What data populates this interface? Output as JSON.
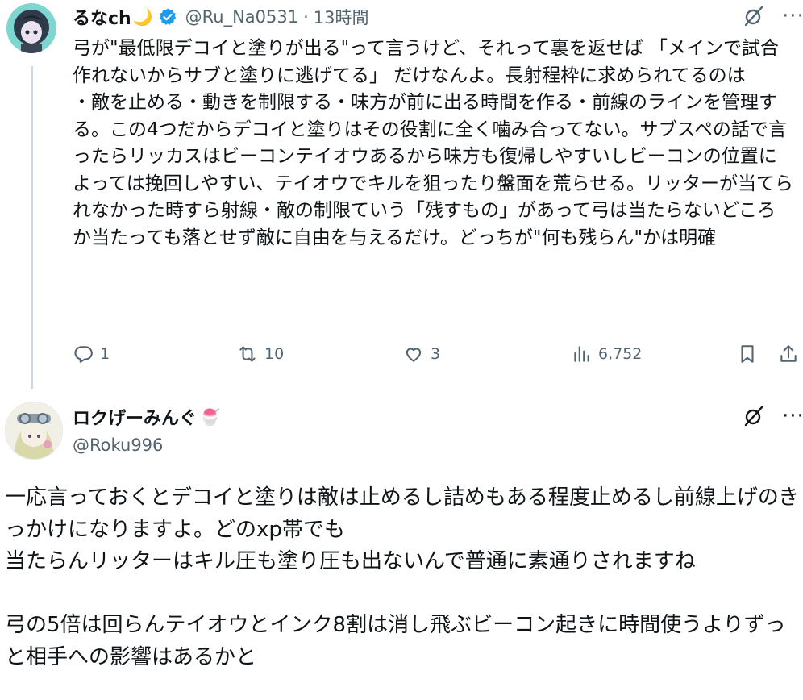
{
  "tweet1": {
    "name": "るなch",
    "name_emoji": "🌙",
    "handle": "@Ru_Na0531",
    "separator": "·",
    "time": "13時間",
    "text": "弓が\"最低限デコイと塗りが出る\"って言うけど、それって裏を返せば 「メインで試合作れないからサブと塗りに逃げてる」 だけなんよ。長射程枠に求められてるのは\n・敵を止める・動きを制限する・味方が前に出る時間を作る・前線のラインを管理する。この4つだからデコイと塗りはその役割に全く噛み合ってない。サブスペの話で言ったらリッカスはビーコンテイオウあるから味方も復帰しやすいしビーコンの位置によっては挽回しやすい、テイオウでキルを狙ったり盤面を荒らせる。リッターが当てられなかった時すら射線・敵の制限ていう「残すもの」があって弓は当たらないどころか当たっても落とせず敵に自由を与えるだけ。どっちが\"何も残らん\"かは明確",
    "replies": "1",
    "reposts": "10",
    "likes": "3",
    "views": "6,752",
    "icons": [
      "grok-icon",
      "more-icon",
      "reply-icon",
      "repost-icon",
      "like-icon",
      "views-icon",
      "bookmark-icon",
      "share-icon"
    ]
  },
  "tweet2": {
    "name": "ロクげーみんぐ",
    "name_emoji": "🍧",
    "handle": "@Roku996",
    "text": "一応言っておくとデコイと塗りは敵は止めるし詰めもある程度止めるし前線上げのきっかけになりますよ。どのxp帯でも\n当たらんリッターはキル圧も塗り圧も出ないんで普通に素通りされますね\n\n弓の5倍は回らんテイオウとインク8割は消し飛ぶビーコン起きに時間使うよりずっと相手への影響はあるかと"
  },
  "colors": {
    "verified": "#1d9bf0",
    "secondary": "#536471",
    "thread_line": "#cfd9de"
  }
}
